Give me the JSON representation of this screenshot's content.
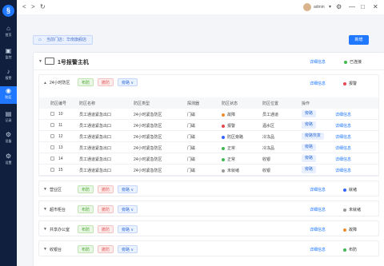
{
  "sidebar": {
    "logo": "§",
    "items": [
      {
        "label": "首页",
        "icon": "⌂"
      },
      {
        "label": "监控",
        "icon": "▣"
      },
      {
        "label": "报警",
        "icon": "♪"
      },
      {
        "label": "防区",
        "icon": "◉"
      },
      {
        "label": "记录",
        "icon": "▤"
      },
      {
        "label": "设备",
        "icon": "⚙"
      },
      {
        "label": "设置",
        "icon": "⚙"
      }
    ]
  },
  "topbar": {
    "back": "<",
    "forward": ">",
    "refresh": "↻",
    "username": "admin",
    "user_caret": "▾",
    "settings": "⚙",
    "minimize": "—",
    "maximize": "□",
    "close": "✕"
  },
  "toolbar": {
    "store_icon": "⌂",
    "current_store": "当前门店：华南旗舰店",
    "add_label": "新增"
  },
  "host": {
    "caret": "▼",
    "title": "1号报警主机",
    "detail_label": "详细信息",
    "status": "已连接",
    "status_color": "#3fb950"
  },
  "zone_open": {
    "caret": "▲",
    "name": "24小时防区",
    "tags": [
      "布防",
      "撤防",
      "旁路 ∨"
    ],
    "detail_label": "详细信息",
    "status": "报警",
    "status_color": "#e5484d",
    "columns": [
      "防区编号",
      "防区名称",
      "防区类型",
      "探测器",
      "防区状态",
      "防区位置",
      "操作"
    ],
    "rows": [
      {
        "no": "10",
        "name": "员工通道紧急出口",
        "type": "24小时紧急防区",
        "detector": "门磁",
        "state": "故障",
        "state_color": "#f08c2e",
        "location": "员工通道",
        "action": "旁路",
        "detail": "详细信息"
      },
      {
        "no": "11",
        "name": "员工通道紧急出口",
        "type": "24小时紧急防区",
        "detector": "门磁",
        "state": "报警",
        "state_color": "#e5484d",
        "location": "酒水区",
        "action": "旁路",
        "detail": "详细信息"
      },
      {
        "no": "12",
        "name": "员工通道紧急出口",
        "type": "24小时紧急防区",
        "detector": "门磁",
        "state": "防区旁路",
        "state_color": "#3366ff",
        "location": "冷冻品",
        "action": "旁路恢复",
        "detail": "详细信息"
      },
      {
        "no": "13",
        "name": "员工通道紧急出口",
        "type": "24小时紧急防区",
        "detector": "门磁",
        "state": "正常",
        "state_color": "#3fb950",
        "location": "冷冻品",
        "action": "旁路",
        "detail": "详细信息"
      },
      {
        "no": "14",
        "name": "员工通道紧急出口",
        "type": "24小时紧急防区",
        "detector": "门磁",
        "state": "正常",
        "state_color": "#3fb950",
        "location": "收银",
        "action": "旁路",
        "detail": "详细信息"
      },
      {
        "no": "15",
        "name": "员工通道紧急出口",
        "type": "24小时紧急防区",
        "detector": "门磁",
        "state": "未就绪",
        "state_color": "#999999",
        "location": "收银",
        "action": "旁路",
        "detail": "详细信息"
      }
    ]
  },
  "zones": [
    {
      "caret": "▼",
      "name": "营业区",
      "tags": [
        "布防",
        "撤防",
        "旁路 ∨"
      ],
      "detail_label": "详细信息",
      "status": "就绪",
      "status_color": "#3366ff"
    },
    {
      "caret": "▼",
      "name": "超市柜台",
      "tags": [
        "布防",
        "撤防",
        "旁路 ∨"
      ],
      "detail_label": "详细信息",
      "status": "未就绪",
      "status_color": "#999999"
    },
    {
      "caret": "▼",
      "name": "共享办公室",
      "tags": [
        "布防",
        "撤防",
        "旁路 ∨"
      ],
      "detail_label": "详细信息",
      "status": "故障",
      "status_color": "#f08c2e"
    },
    {
      "caret": "▼",
      "name": "收银台",
      "tags": [
        "布防",
        "撤防",
        "旁路 ∨"
      ],
      "detail_label": "详细信息",
      "status": "布防",
      "status_color": "#3fb950"
    }
  ]
}
